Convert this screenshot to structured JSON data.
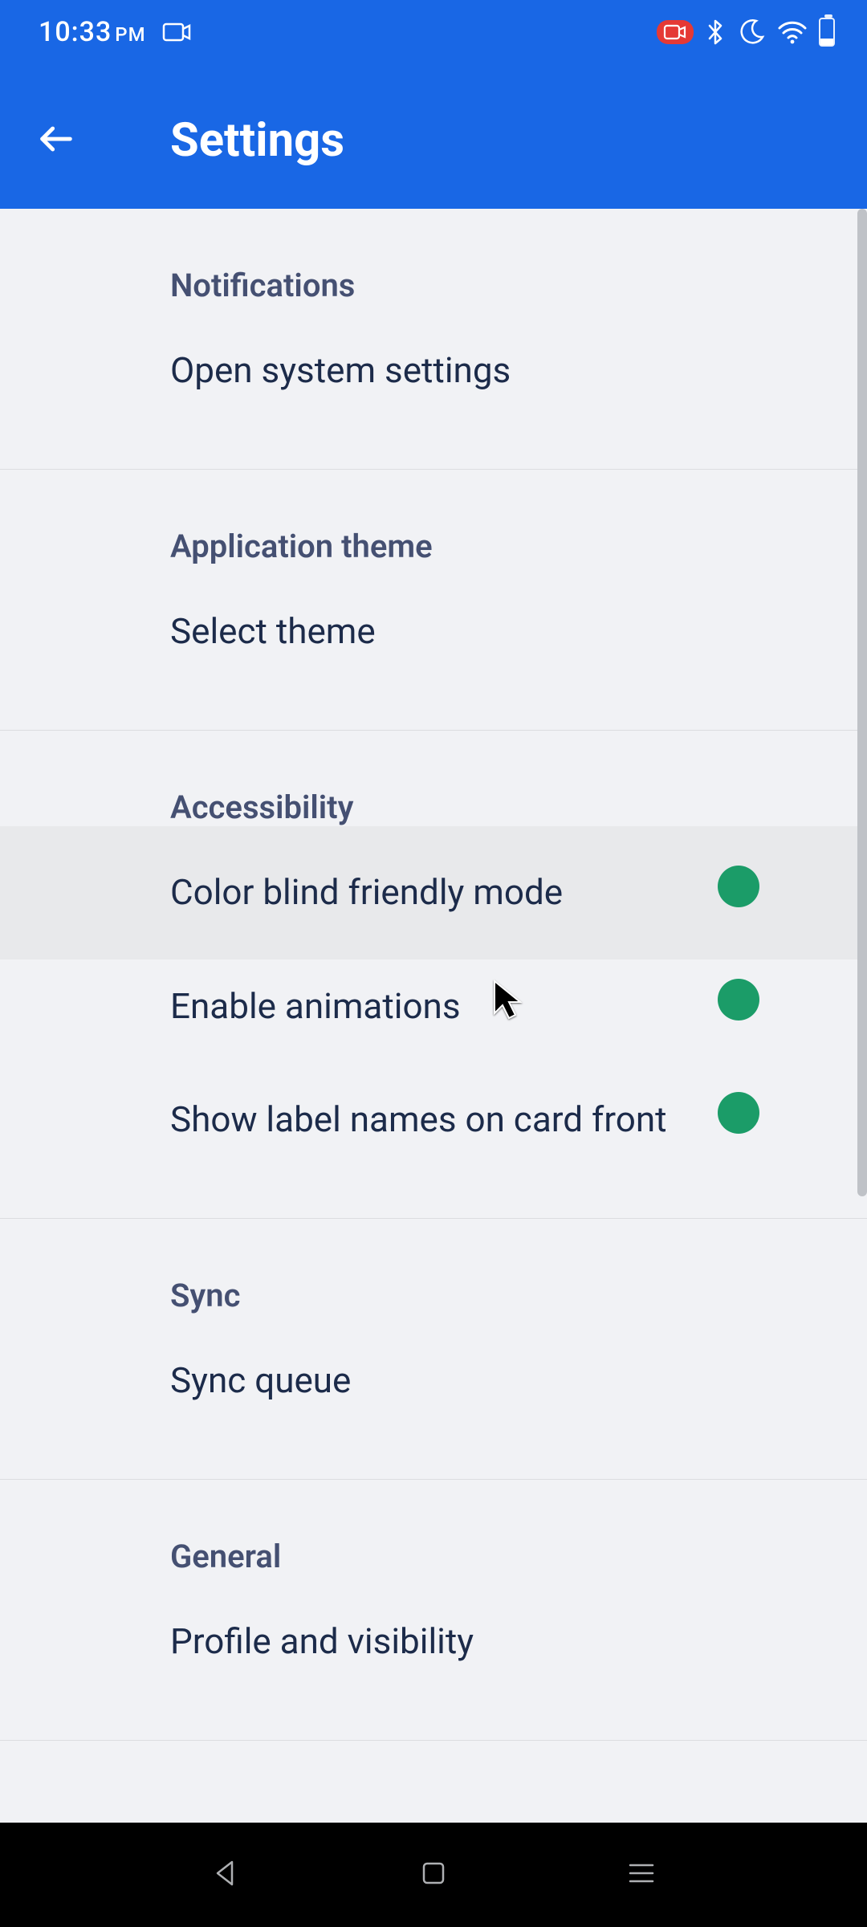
{
  "status": {
    "time": "10:33",
    "ampm": "PM"
  },
  "header": {
    "title": "Settings"
  },
  "sections": {
    "notifications": {
      "header": "Notifications",
      "open_system": "Open system settings"
    },
    "theme": {
      "header": "Application theme",
      "select": "Select theme"
    },
    "accessibility": {
      "header": "Accessibility",
      "colorblind": "Color blind friendly mode",
      "animations": "Enable animations",
      "labels": "Show label names on card front"
    },
    "sync": {
      "header": "Sync",
      "queue": "Sync queue"
    },
    "general": {
      "header": "General",
      "profile": "Profile and visibility"
    }
  },
  "toggles": {
    "colorblind": true,
    "animations": true,
    "labels": true
  },
  "colors": {
    "primary": "#1967e5",
    "toggle_on": "#1b9c68",
    "toggle_track": "#8ed0b9"
  }
}
